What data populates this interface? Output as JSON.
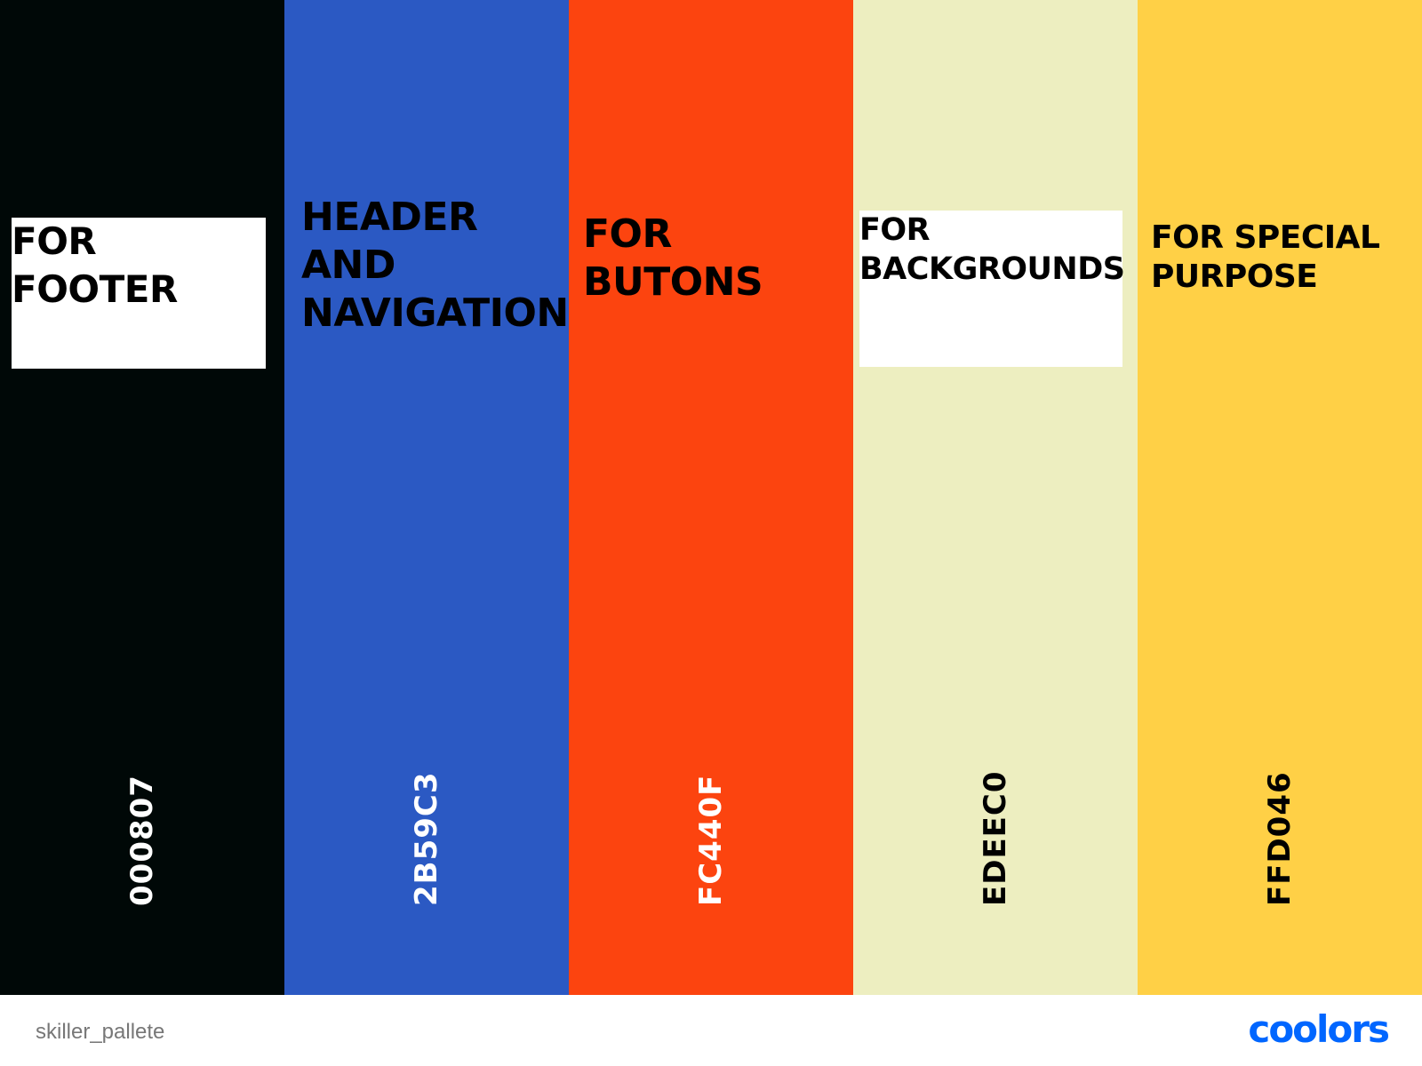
{
  "palette": {
    "swatches": [
      {
        "hex": "000807",
        "color": "#000807",
        "hex_text_color": "#ffffff",
        "note": "FOR\nFOOTER",
        "note_boxed": true
      },
      {
        "hex": "2B59C3",
        "color": "#2B59C3",
        "hex_text_color": "#ffffff",
        "note": "HEADER\nAND\nNAVIGATION",
        "note_boxed": false
      },
      {
        "hex": "FC440F",
        "color": "#FC440F",
        "hex_text_color": "#ffffff",
        "note": "FOR\nBUTONS",
        "note_boxed": false
      },
      {
        "hex": "EDEEC0",
        "color": "#EDEEC0",
        "hex_text_color": "#000000",
        "note": "FOR\nBACKGROUNDS",
        "note_boxed": true
      },
      {
        "hex": "FFD046",
        "color": "#FFD046",
        "hex_text_color": "#000000",
        "note": "FOR SPECIAL\nPURPOSE",
        "note_boxed": false
      }
    ]
  },
  "footer": {
    "palette_name": "skiller_pallete",
    "brand": "coolors",
    "brand_color": "#0066FF"
  }
}
